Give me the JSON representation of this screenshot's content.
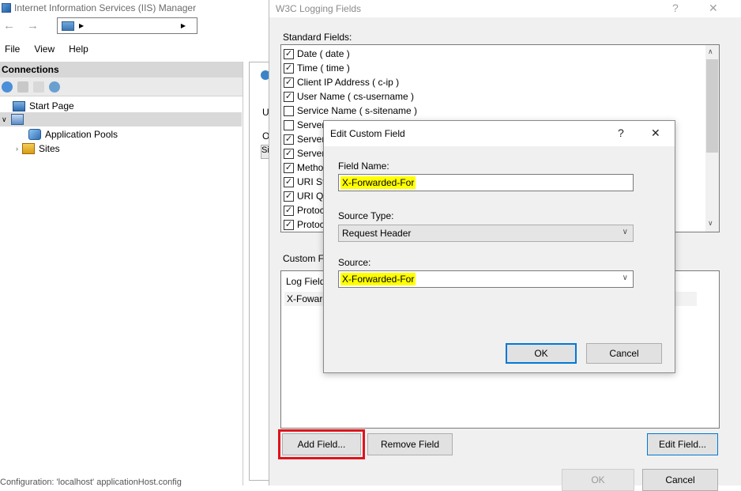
{
  "iis": {
    "window_title": "Internet Information Services (IIS) Manager",
    "menu": [
      "File",
      "View",
      "Help"
    ],
    "connections_header": "Connections",
    "tree": [
      {
        "label": "Start Page"
      },
      {
        "label": ""
      },
      {
        "label": "Application Pools"
      },
      {
        "label": "Sites"
      }
    ],
    "status_text": "Configuration: 'localhost' applicationHost.config"
  },
  "w3c": {
    "title": "W3C Logging Fields",
    "help_glyph": "?",
    "close_glyph": "✕",
    "standard_label": "Standard Fields:",
    "fields": [
      {
        "label": "Date ( date )",
        "checked": true
      },
      {
        "label": "Time ( time )",
        "checked": true
      },
      {
        "label": "Client IP Address ( c-ip )",
        "checked": true
      },
      {
        "label": "User Name ( cs-username )",
        "checked": true
      },
      {
        "label": "Service Name ( s-sitename )",
        "checked": false
      },
      {
        "label": "Server",
        "checked": false
      },
      {
        "label": "Server",
        "checked": true
      },
      {
        "label": "Server",
        "checked": true
      },
      {
        "label": "Metho",
        "checked": true
      },
      {
        "label": "URI Ste",
        "checked": true
      },
      {
        "label": "URI Qu",
        "checked": true
      },
      {
        "label": "Protoc",
        "checked": true
      },
      {
        "label": "Protoc",
        "checked": true
      }
    ],
    "custom_label": "Custom F",
    "custom_header": "Log Field",
    "custom_row": "X-Foward",
    "add_field": "Add Field...",
    "remove_field": "Remove Field",
    "edit_field": "Edit Field...",
    "ok": "OK",
    "cancel": "Cancel"
  },
  "edit": {
    "title": "Edit Custom Field",
    "help_glyph": "?",
    "close_glyph": "✕",
    "field_name_label": "Field Name:",
    "field_name_value": "X-Forwarded-For",
    "source_type_label": "Source Type:",
    "source_type_value": "Request Header",
    "source_label": "Source:",
    "source_value": "X-Forwarded-For",
    "ok": "OK",
    "cancel": "Cancel"
  },
  "colors": {
    "highlight": "#ffff00",
    "annotation_outline": "#e0131b",
    "focus_blue": "#0078d7"
  }
}
